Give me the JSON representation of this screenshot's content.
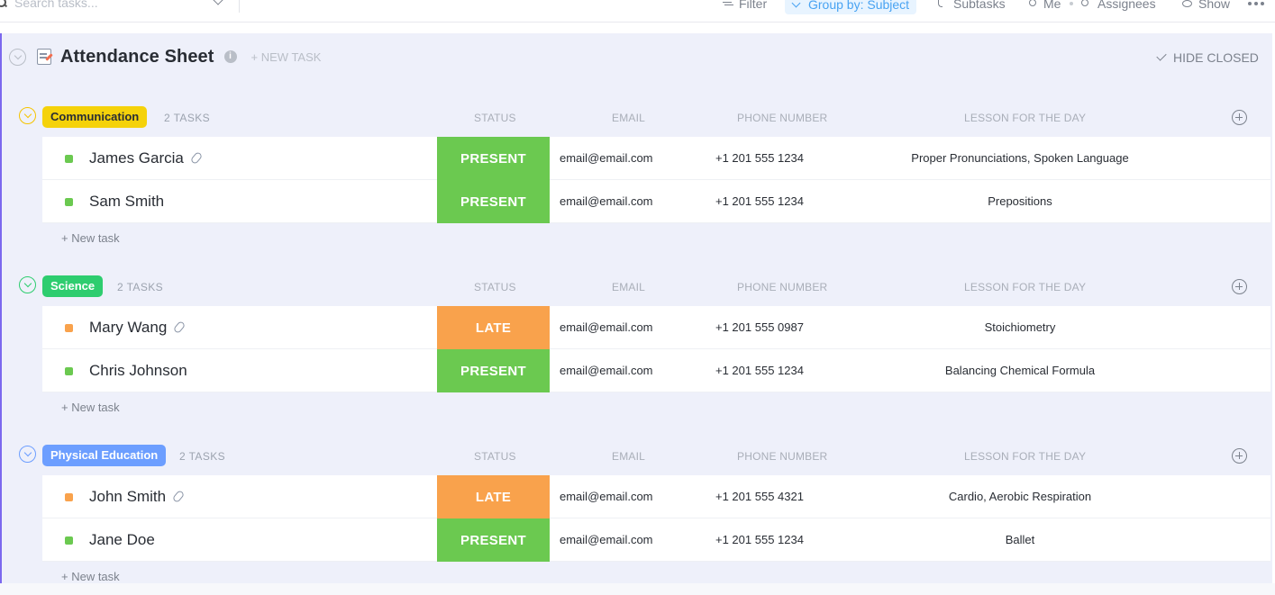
{
  "toolbar": {
    "search_placeholder": "Search tasks...",
    "filter_label": "Filter",
    "groupby_label": "Group by: Subject",
    "subtasks_label": "Subtasks",
    "me_label": "Me",
    "assignees_label": "Assignees",
    "show_label": "Show"
  },
  "list": {
    "title": "Attendance Sheet",
    "new_task_label": "+ NEW TASK",
    "hide_closed_label": "HIDE CLOSED"
  },
  "columns": {
    "status": "STATUS",
    "email": "EMAIL",
    "phone": "PHONE NUMBER",
    "lesson": "LESSON FOR THE DAY"
  },
  "new_task_row_label": "+ New task",
  "colors": {
    "present": "#6bc950",
    "late": "#f9a24c",
    "communication": "#f5d20a",
    "science": "#2ecd6f",
    "physical_education": "#6c9eff"
  },
  "groups": [
    {
      "name": "Communication",
      "count": "2 TASKS",
      "tasks": [
        {
          "name": "James Garcia",
          "attachment": true,
          "status": "PRESENT",
          "email": "email@email.com",
          "phone": "+1 201 555 1234",
          "lesson": "Proper Pronunciations, Spoken Language"
        },
        {
          "name": "Sam Smith",
          "attachment": false,
          "status": "PRESENT",
          "email": "email@email.com",
          "phone": "+1 201 555 1234",
          "lesson": "Prepositions"
        }
      ]
    },
    {
      "name": "Science",
      "count": "2 TASKS",
      "tasks": [
        {
          "name": "Mary Wang",
          "attachment": true,
          "status": "LATE",
          "email": "email@email.com",
          "phone": "+1 201 555 0987",
          "lesson": "Stoichiometry"
        },
        {
          "name": "Chris Johnson",
          "attachment": false,
          "status": "PRESENT",
          "email": "email@email.com",
          "phone": "+1 201 555 1234",
          "lesson": "Balancing Chemical Formula"
        }
      ]
    },
    {
      "name": "Physical Education",
      "count": "2 TASKS",
      "tasks": [
        {
          "name": "John Smith",
          "attachment": true,
          "status": "LATE",
          "email": "email@email.com",
          "phone": "+1 201 555 4321",
          "lesson": "Cardio, Aerobic Respiration"
        },
        {
          "name": "Jane Doe",
          "attachment": false,
          "status": "PRESENT",
          "email": "email@email.com",
          "phone": "+1 201 555 1234",
          "lesson": "Ballet"
        }
      ]
    }
  ]
}
